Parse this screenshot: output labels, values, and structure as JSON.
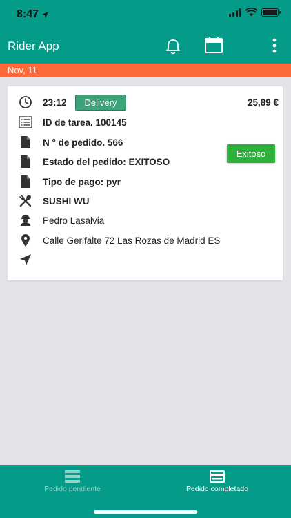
{
  "status_bar": {
    "time": "8:47"
  },
  "header": {
    "title": "Rider App"
  },
  "date_bar": {
    "date": "Nov, 11"
  },
  "order": {
    "time": "23:12",
    "type_badge": "Delivery",
    "price": "25,89 €",
    "task_id": "ID de tarea. 100145",
    "order_number": "N ° de pedido. 566",
    "order_status": "Estado del pedido: EXITOSO",
    "payment_type": "Tipo de pago: pyr",
    "restaurant": "SUSHI WU",
    "customer": "Pedro Lasalvia",
    "address": "Calle Gerifalte 72 Las Rozas de Madrid ES",
    "status_button": "Exitoso"
  },
  "bottom_nav": {
    "pending_label": "Pedido pendiente",
    "completed_label": "Pedido completado"
  },
  "colors": {
    "primary": "#049b88",
    "date_bar": "#fd6a3a",
    "delivery_badge": "#3ba27a",
    "success_button": "#2db13a"
  }
}
